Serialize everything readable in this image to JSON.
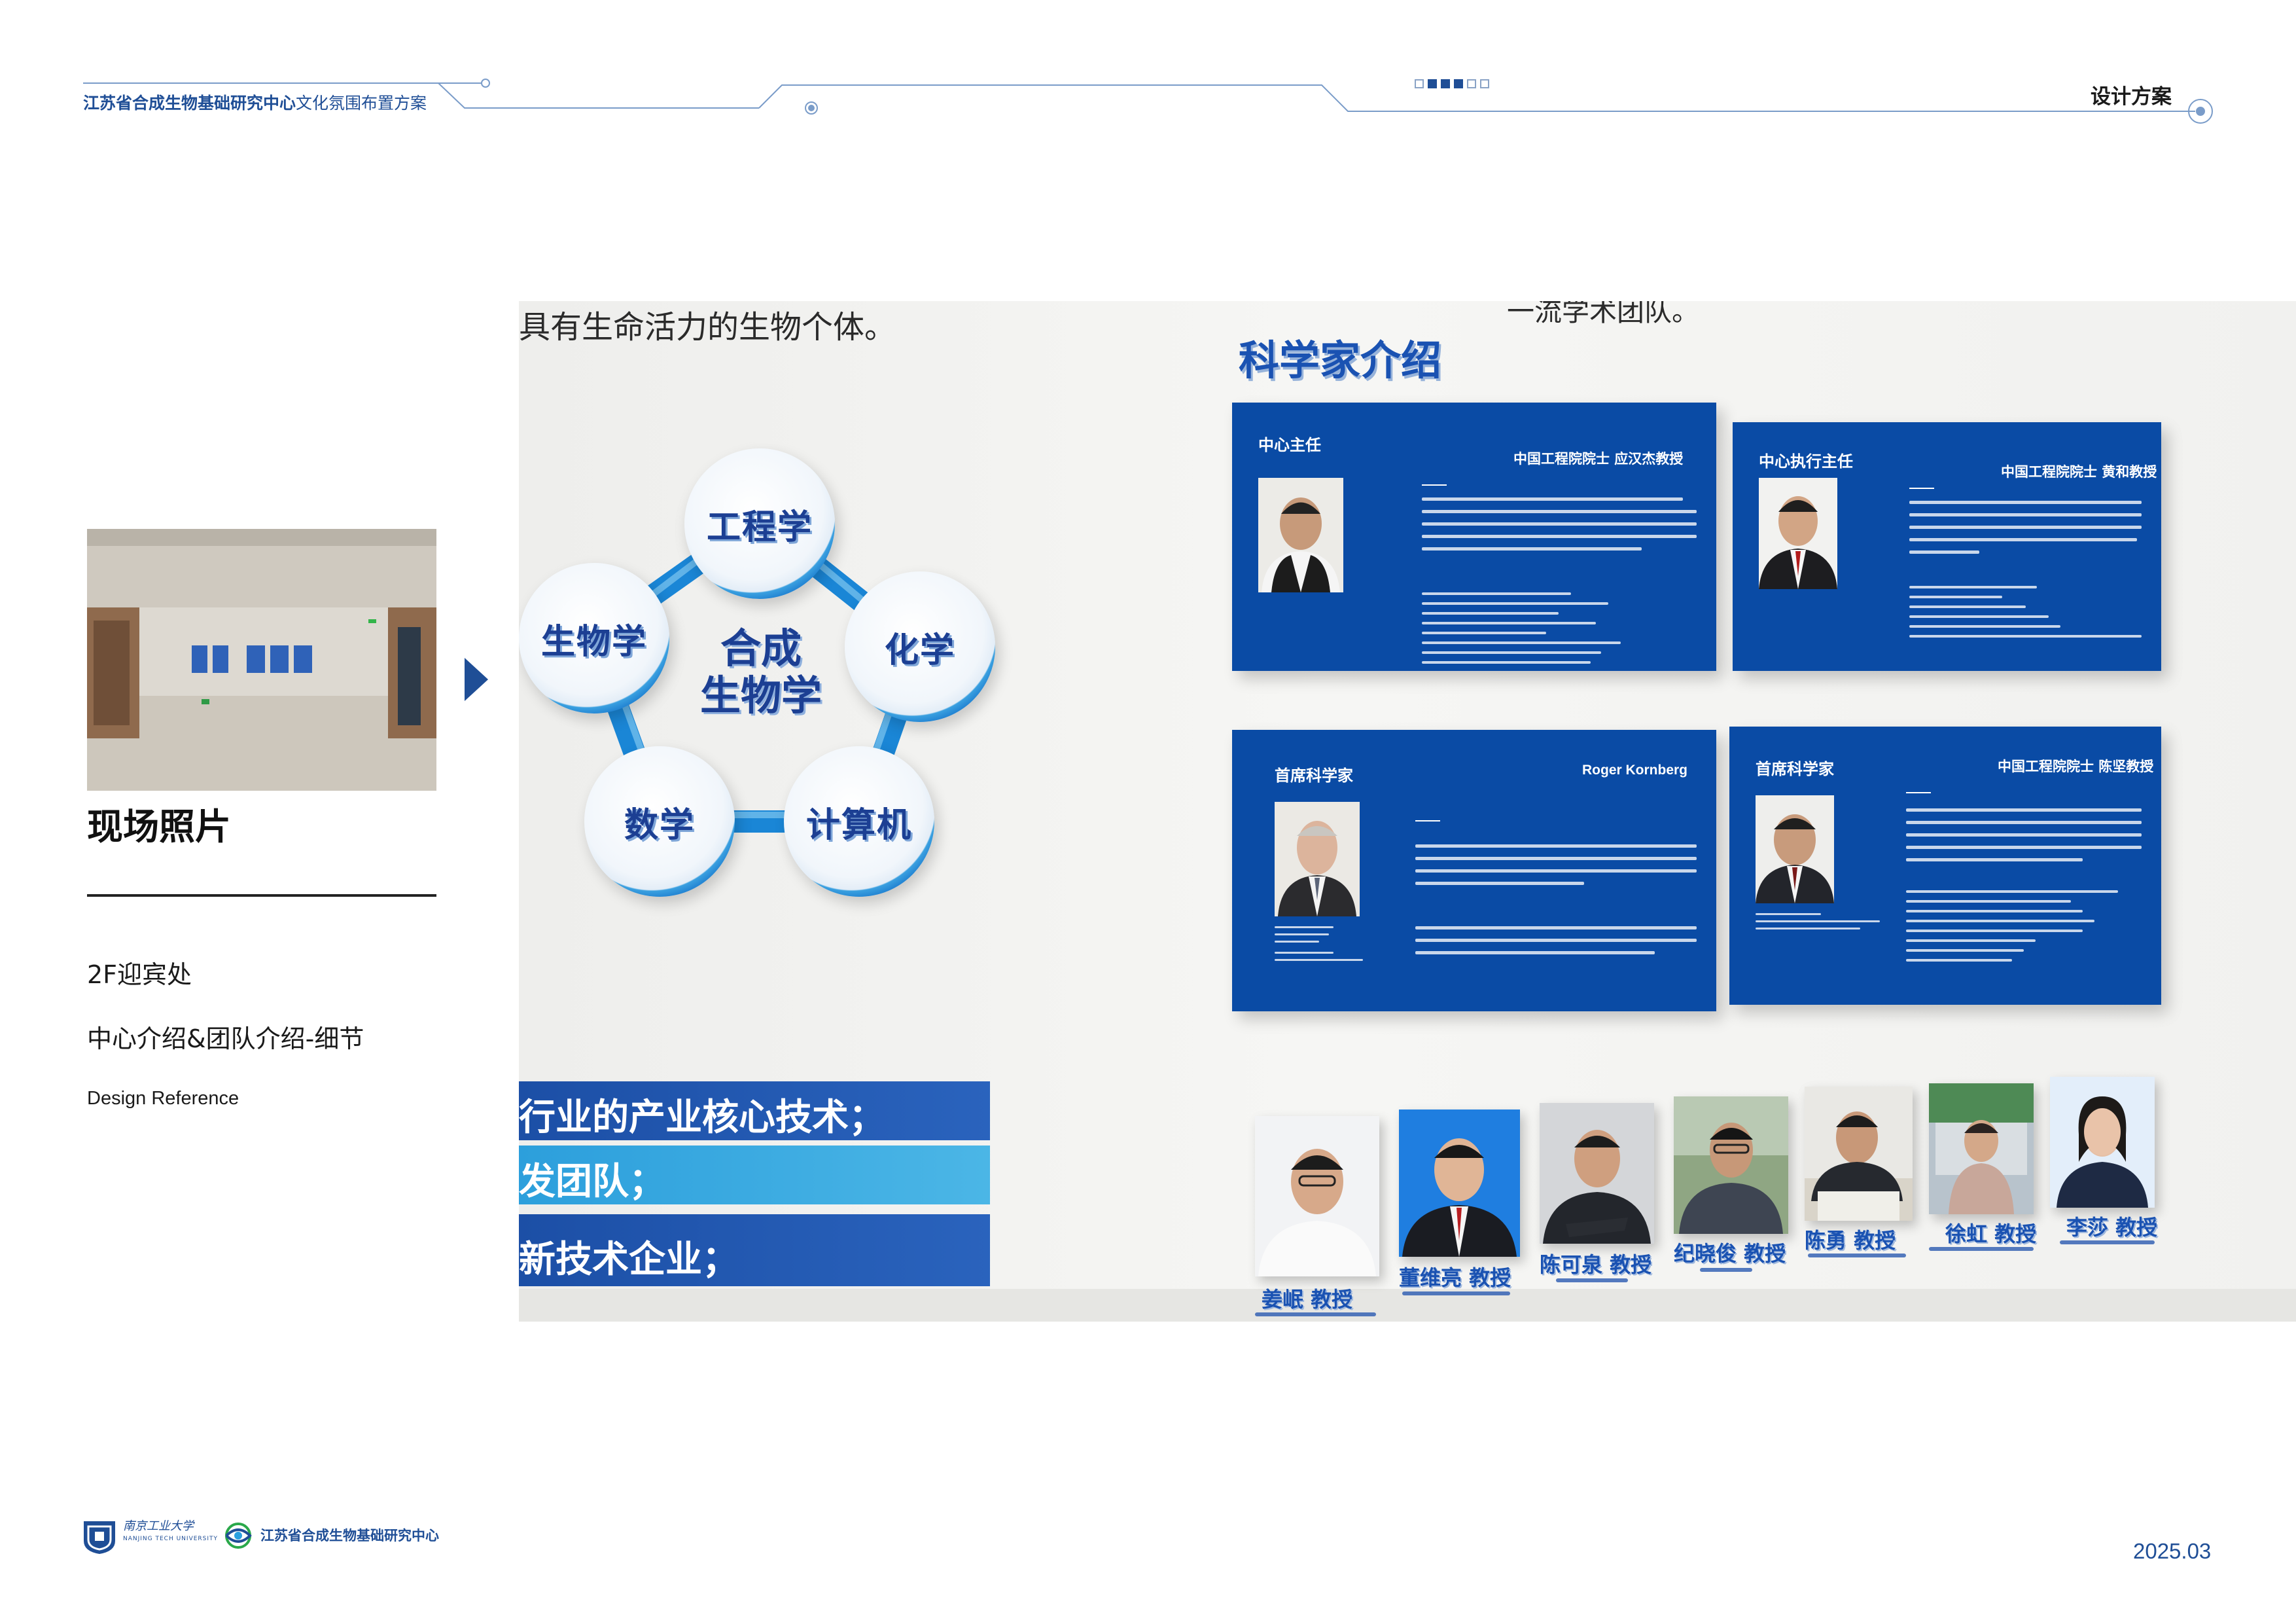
{
  "header": {
    "title_bold": "江苏省合成生物基础研究中心",
    "title_rest": "文化氛围布置方案",
    "section": "设计方案",
    "pager": {
      "active": [
        2,
        3,
        4
      ],
      "total": 6
    }
  },
  "left": {
    "photo_heading": "现场照片",
    "location": "2F迎宾处",
    "description": "中心介绍&团队介绍-细节",
    "reference": "Design Reference"
  },
  "render": {
    "top_text": "具有生命活力的生物个体。",
    "top_text_right": "一流学术团队。",
    "center_title_line1": "合成",
    "center_title_line2": "生物学",
    "nodes": [
      "工程学",
      "化学",
      "计算机",
      "数学",
      "生物学"
    ],
    "stripes": [
      "行业的产业核心技术；",
      "发团队；",
      "新技术企业；"
    ],
    "scientist_heading": "科学家介绍",
    "panels": [
      {
        "role": "中心主任",
        "name": "中国工程院院士 应汉杰教授"
      },
      {
        "role": "中心执行主任",
        "name": "中国工程院院士 黄和教授"
      },
      {
        "role": "首席科学家",
        "name": "Roger Kornberg"
      },
      {
        "role": "首席科学家",
        "name": "中国工程院院士 陈坚教授"
      }
    ],
    "professors": [
      {
        "name": "姜岷 教授"
      },
      {
        "name": "董维亮 教授"
      },
      {
        "name": "陈可泉 教授"
      },
      {
        "name": "纪晓俊 教授"
      },
      {
        "name": "陈勇 教授"
      },
      {
        "name": "徐虹 教授"
      },
      {
        "name": "李莎 教授"
      }
    ]
  },
  "footer": {
    "university_name": "南京工业大学",
    "university_en": "NANJING TECH UNIVERSITY",
    "center_name": "江苏省合成生物基础研究中心",
    "date": "2025.03"
  },
  "colors": {
    "brand_blue": "#1f4e96",
    "panel_blue": "#0a4ba5",
    "accent_cyan": "#2aa0e0"
  }
}
